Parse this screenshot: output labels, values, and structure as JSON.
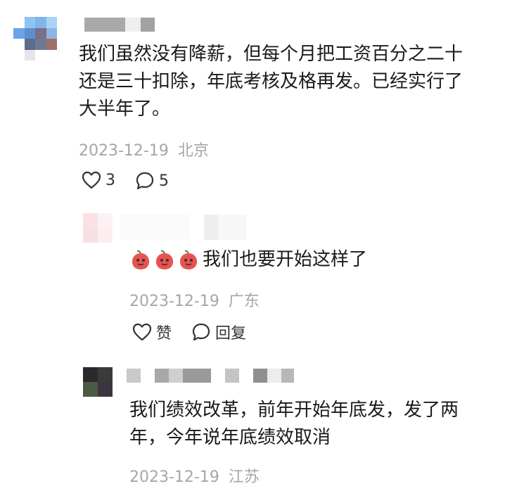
{
  "comments": [
    {
      "text": "我们虽然没有降薪，但每个月把工资百分之二十还是三十扣除，年底考核及格再发。已经实行了大半年了。",
      "text_lines": [
        "我们虽然没有降薪，但每个月把工资百分之二十",
        "还是三十扣除，年底考核及格再发。已经实行了",
        "大半年了。"
      ],
      "date": "2023-12-19",
      "location": "北京",
      "likes": "3",
      "replies_count": "5",
      "like_icon": "heart-icon",
      "reply_icon": "comment-bubble-icon"
    }
  ],
  "replies": [
    {
      "emoji_prefix": "🍑🍑🍑",
      "text": "我们也要开始这样了",
      "date": "2023-12-19",
      "location": "广东",
      "like_label": "赞",
      "reply_label": "回复"
    },
    {
      "text": "我们绩效改革，前年开始年底发，发了两年，今年说年底绩效取消",
      "text_lines": [
        "我们绩效改革，前年开始年底发，发了两",
        "年，今年说年底绩效取消"
      ],
      "date": "2023-12-19",
      "location": "江苏"
    }
  ],
  "colors": {
    "text": "#1a1a1a",
    "meta": "#a6a6a6",
    "icon": "#333333"
  }
}
